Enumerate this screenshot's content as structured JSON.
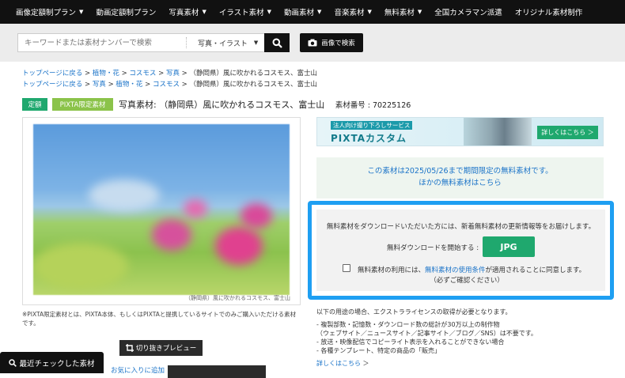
{
  "nav": {
    "items": [
      {
        "label": "画像定額制プラン",
        "caret": true
      },
      {
        "label": "動画定額制プラン",
        "caret": false
      },
      {
        "label": "写真素材",
        "caret": true
      },
      {
        "label": "イラスト素材",
        "caret": true
      },
      {
        "label": "動画素材",
        "caret": true
      },
      {
        "label": "音楽素材",
        "caret": true
      },
      {
        "label": "無料素材",
        "caret": true
      },
      {
        "label": "全国カメラマン派遣",
        "caret": false
      },
      {
        "label": "オリジナル素材制作",
        "caret": false
      }
    ]
  },
  "search": {
    "placeholder": "キーワードまたは素材ナンバーで検索",
    "type_label": "写真・イラスト",
    "image_search_label": "画像で検索"
  },
  "breadcrumbs": [
    {
      "links": [
        "トップページに戻る",
        "植物・花",
        "コスモス",
        "写真"
      ],
      "current": "（静岡県）風に吹かれるコスモス、富士山"
    },
    {
      "links": [
        "トップページに戻る",
        "写真",
        "植物・花",
        "コスモス"
      ],
      "current": "（静岡県）風に吹かれるコスモス、富士山"
    }
  ],
  "badges": {
    "fixed": "定額",
    "limited": "PIXTA限定素材"
  },
  "title": {
    "text": "写真素材: （静岡県）風に吹かれるコスモス、富士山",
    "number": "素材番号 : 70225126"
  },
  "photo": {
    "caption": "（静岡県）風に吹かれるコスモス、富士山"
  },
  "note": "※PIXTA限定素材とは、PIXTA本体、もしくはPIXTAと提携しているサイトでのみご購入いただける素材です。",
  "preview_label": "切り抜きプレビュー",
  "recent_label": "最近チェックした素材",
  "favorite_label": "お気に入りに追加",
  "banner": {
    "sub": "法人向け撮り下ろしサービス",
    "title": "PIXTAカスタム",
    "cta": "詳しくはこちら ＞"
  },
  "free_box": {
    "line1": "この素材は2025/05/26まで期間限定の無料素材です。",
    "line2_prefix": "ほかの",
    "line2_link": "無料素材はこちら"
  },
  "download": {
    "message": "無料素材をダウンロードいただいた方には、新着無料素材の更新情報等をお届けします。",
    "start_label": "無料ダウンロードを開始する",
    "format": "JPG",
    "agree_prefix": "無料素材の利用には、",
    "agree_link": "無料素材の使用条件",
    "agree_suffix": "が適用されることに同意します。",
    "agree_note": "（必ずご確認ください）",
    "checked": false
  },
  "license": {
    "head": "以下の用途の場合、エクストラライセンスの取得が必要となります。",
    "items": [
      "- 複製部数・記憶数・ダウンロード数の総計が30万以上の制作物",
      "（ウェブサイト／ニュースサイト／記事サイト／ブログ／SNS）は不要です。",
      "- 放送・映像配信でコピーライト表示を入れることができない場合",
      "- 各種テンプレート、特定の商品の「販売」"
    ],
    "more": "詳しくはこちら"
  }
}
